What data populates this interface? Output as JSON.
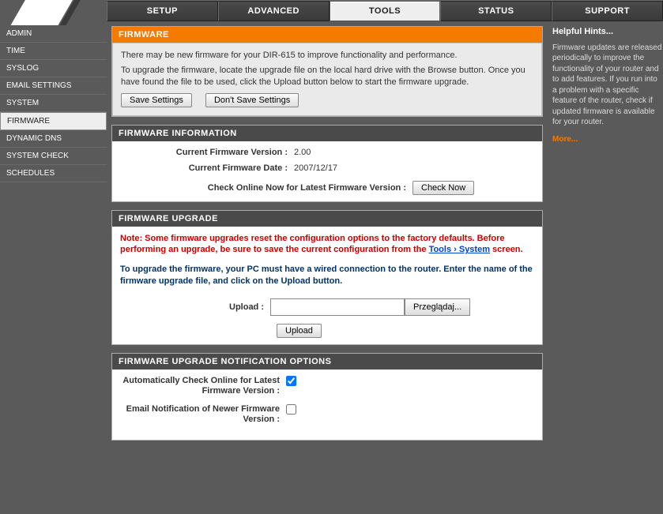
{
  "topTabs": {
    "setup": "SETUP",
    "advanced": "ADVANCED",
    "tools": "TOOLS",
    "status": "STATUS",
    "support": "SUPPORT"
  },
  "sidebar": {
    "items": [
      "ADMIN",
      "TIME",
      "SYSLOG",
      "EMAIL SETTINGS",
      "SYSTEM",
      "FIRMWARE",
      "DYNAMIC DNS",
      "SYSTEM CHECK",
      "SCHEDULES"
    ],
    "activeIndex": 5
  },
  "firmwarePanel": {
    "title": "FIRMWARE",
    "desc1": "There may be new firmware for your DIR-615 to improve functionality and performance.",
    "desc2": "To upgrade the firmware, locate the upgrade file on the local hard drive with the Browse button. Once you have found the file to be used, click the Upload button below to start the firmware upgrade.",
    "saveBtn": "Save Settings",
    "dontSaveBtn": "Don't Save Settings"
  },
  "infoPanel": {
    "title": "FIRMWARE INFORMATION",
    "versionLabel": "Current Firmware Version :",
    "versionValue": "2.00",
    "dateLabel": "Current Firmware Date :",
    "dateValue": "2007/12/17",
    "checkLabel": "Check Online Now for Latest Firmware Version :",
    "checkBtn": "Check Now"
  },
  "upgradePanel": {
    "title": "FIRMWARE UPGRADE",
    "noteA": "Note: Some firmware upgrades reset the configuration options to the factory defaults. Before performing an upgrade, be sure to save the current configuration from the ",
    "noteLink": "Tools  › System",
    "noteB": " screen.",
    "instr": "To upgrade the firmware, your PC must have a wired connection to the router. Enter the name of the firmware upgrade file, and click on the Upload button.",
    "uploadLabel": "Upload :",
    "browseBtn": "Przeglądaj...",
    "uploadBtn": "Upload"
  },
  "notifyPanel": {
    "title": "FIRMWARE UPGRADE NOTIFICATION OPTIONS",
    "autoCheckLabel": "Automatically Check Online for Latest Firmware Version :",
    "autoCheckChecked": true,
    "emailLabel": "Email Notification of Newer Firmware Version :",
    "emailChecked": false
  },
  "hints": {
    "title": "Helpful Hints...",
    "body": "Firmware updates are released periodically to improve the functionality of your router and to add features. If you run into a problem with a specific feature of the router, check if updated firmware is available for your router.",
    "more": "More..."
  }
}
